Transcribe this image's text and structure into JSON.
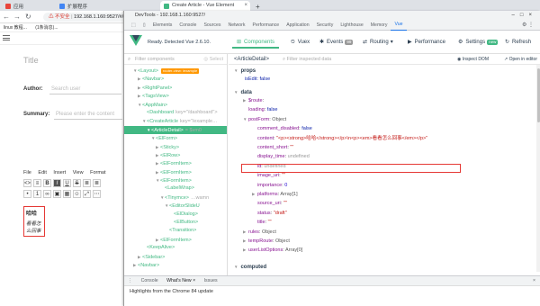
{
  "browser": {
    "tabs": [
      {
        "label": "应用",
        "active": false
      },
      {
        "label": "扩展程序",
        "active": false
      },
      {
        "label": "Create Article - Vue Element",
        "active": true
      }
    ],
    "address": {
      "warning": "不安全",
      "url": "192.168.1.160:9527/#/example/create"
    },
    "bookmarks": [
      "linux 教程...",
      "(1条消息)..."
    ]
  },
  "page": {
    "title_placeholder": "Title",
    "author_label": "Author:",
    "author_placeholder": "Search user",
    "summary_label": "Summary:",
    "summary_placeholder": "Please enter the content",
    "menu": [
      "File",
      "Edit",
      "Insert",
      "View",
      "Format"
    ],
    "editor_bold": "哈哈",
    "editor_italic": "看看怎么回事"
  },
  "devtools": {
    "title": "DevTools - 192.168.1.160:9527/",
    "tabs": [
      "Elements",
      "Console",
      "Sources",
      "Network",
      "Performance",
      "Application",
      "Security",
      "Lighthouse",
      "Memory",
      "Vue"
    ],
    "active_tab": "Vue",
    "vue": {
      "ready": "Ready. Detected Vue 2.6.10.",
      "nav": [
        {
          "label": "Components",
          "icon": "components-icon",
          "active": true
        },
        {
          "label": "Vuex",
          "icon": "vuex-icon",
          "active": false
        },
        {
          "label": "Events",
          "icon": "events-icon",
          "active": false,
          "badge": "99"
        },
        {
          "label": "Routing",
          "icon": "routing-icon",
          "active": false
        },
        {
          "label": "Performance",
          "icon": "performance-icon",
          "active": false
        },
        {
          "label": "Settings",
          "icon": "settings-icon",
          "active": false,
          "badge": "new"
        },
        {
          "label": "Refresh",
          "icon": "refresh-icon",
          "active": false
        }
      ],
      "filter_components": "Filter components",
      "select_label": "Select",
      "component_title": "<ArticleDetail>",
      "filter_data": "Filter inspected data",
      "inspect_dom": "Inspect DOM",
      "open_editor": "Open in editor",
      "tree": [
        {
          "indent": 2,
          "caret": "▼",
          "name": "<Layout>",
          "chip": "router-view: /example"
        },
        {
          "indent": 3,
          "caret": "▶",
          "name": "<Navbar>"
        },
        {
          "indent": 3,
          "caret": "▶",
          "name": "<RightPanel>"
        },
        {
          "indent": 3,
          "caret": "▶",
          "name": "<TagsView>"
        },
        {
          "indent": 3,
          "caret": "▼",
          "name": "<AppMain>"
        },
        {
          "indent": 4,
          "caret": "",
          "name": "<Dashboard",
          "dim": "key=\"/dashboard\">"
        },
        {
          "indent": 4,
          "caret": "▼",
          "name": "<CreateArticle",
          "dim": "key=\"/example…"
        },
        {
          "indent": 5,
          "caret": "▼",
          "name": "<ArticleDetail>",
          "dim": "= $vm0",
          "highlight": true
        },
        {
          "indent": 6,
          "caret": "▼",
          "name": "<ElForm>"
        },
        {
          "indent": 7,
          "caret": "▶",
          "name": "<Sticky>"
        },
        {
          "indent": 7,
          "caret": "▶",
          "name": "<ElRow>"
        },
        {
          "indent": 7,
          "caret": "▶",
          "name": "<ElFormItem>"
        },
        {
          "indent": 7,
          "caret": "▶",
          "name": "<ElFormItem>"
        },
        {
          "indent": 7,
          "caret": "▼",
          "name": "<ElFormItem>"
        },
        {
          "indent": 8,
          "caret": "",
          "name": "<LabelWrap>"
        },
        {
          "indent": 8,
          "caret": "▼",
          "name": "<Tinymce>",
          "dim": "…wamn"
        },
        {
          "indent": 9,
          "caret": "▼",
          "name": "<EditorSlideU"
        },
        {
          "indent": 10,
          "caret": "",
          "name": "<ElDialog>"
        },
        {
          "indent": 10,
          "caret": "",
          "name": "<ElButton>"
        },
        {
          "indent": 9,
          "caret": "",
          "name": "<Transition>"
        },
        {
          "indent": 7,
          "caret": "▶",
          "name": "<ElFormItem>"
        },
        {
          "indent": 4,
          "caret": "",
          "name": "<KeepAlive>"
        },
        {
          "indent": 3,
          "caret": "▶",
          "name": "<Sidebar>"
        },
        {
          "indent": 2,
          "caret": "▶",
          "name": "<Navbar>"
        }
      ],
      "data": {
        "props_label": "props",
        "isEdit": "isEdit: false",
        "data_label": "data",
        "rows": [
          {
            "indent": 1,
            "caret": "▶",
            "key": "$route",
            "val": "",
            "cls": "obj"
          },
          {
            "indent": 1,
            "caret": "",
            "key": "loading",
            "val": "false",
            "cls": "bool"
          },
          {
            "indent": 1,
            "caret": "▼",
            "key": "postForm",
            "val": "Object",
            "cls": "obj"
          },
          {
            "indent": 2,
            "caret": "",
            "key": "comment_disabled",
            "val": "false",
            "cls": "bool"
          },
          {
            "indent": 2,
            "caret": "",
            "key": "content",
            "val": "\"<p><strong>哈哈</strong></p>\\n<p><em>看看怎么回事</em></p>\"",
            "cls": "str"
          },
          {
            "indent": 2,
            "caret": "",
            "key": "content_short",
            "val": "\"\"",
            "cls": "str"
          },
          {
            "indent": 2,
            "caret": "",
            "key": "display_time",
            "val": "undefined",
            "cls": "gray"
          },
          {
            "indent": 2,
            "caret": "",
            "key": "id",
            "val": "undefined",
            "cls": "gray"
          },
          {
            "indent": 2,
            "caret": "",
            "key": "image_uri",
            "val": "\"\"",
            "cls": "str"
          },
          {
            "indent": 2,
            "caret": "",
            "key": "importance",
            "val": "0",
            "cls": "num"
          },
          {
            "indent": 2,
            "caret": "▶",
            "key": "platforms",
            "val": "Array[1]",
            "cls": "obj"
          },
          {
            "indent": 2,
            "caret": "",
            "key": "source_uri",
            "val": "\"\"",
            "cls": "str"
          },
          {
            "indent": 2,
            "caret": "",
            "key": "status",
            "val": "\"draft\"",
            "cls": "str"
          },
          {
            "indent": 2,
            "caret": "",
            "key": "title",
            "val": "\"\"",
            "cls": "str"
          },
          {
            "indent": 1,
            "caret": "▶",
            "key": "rules",
            "val": "Object",
            "cls": "obj"
          },
          {
            "indent": 1,
            "caret": "▶",
            "key": "tempRoute",
            "val": "Object",
            "cls": "obj"
          },
          {
            "indent": 1,
            "caret": "▶",
            "key": "userListOptions",
            "val": "Array[0]",
            "cls": "obj"
          }
        ],
        "computed_label": "computed"
      }
    },
    "drawer": {
      "tabs": [
        "Console",
        "What's New ×",
        "Issues"
      ],
      "active": "What's New ×",
      "highlights": "Highlights from the Chrome 84 update"
    }
  },
  "colors": {
    "vue_green": "#41b883",
    "accent_red": "#e53935",
    "devtools_blue": "#1a73e8"
  }
}
